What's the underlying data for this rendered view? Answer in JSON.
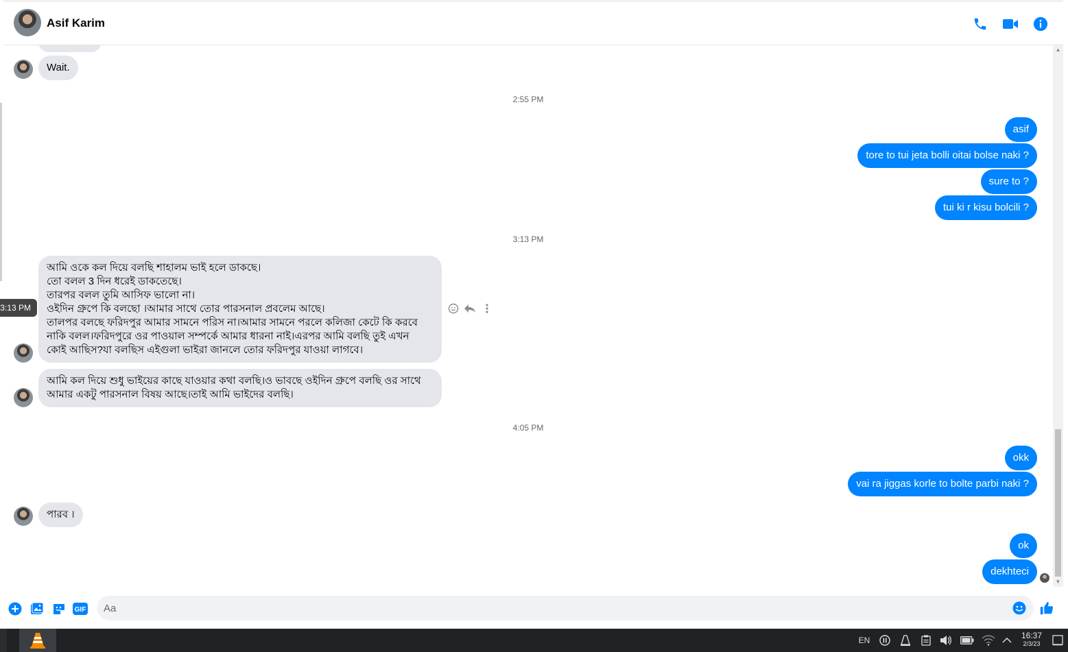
{
  "header": {
    "contact_name": "Asif Karim",
    "icons": [
      "phone-icon",
      "video-icon",
      "info-icon"
    ],
    "accent_color": "#0084ff"
  },
  "thread": {
    "messages": [
      {
        "direction": "in",
        "text": "Wait."
      },
      {
        "direction": "timestamp",
        "text": "2:55 PM"
      },
      {
        "direction": "out",
        "text": "asif"
      },
      {
        "direction": "out",
        "text": "tore to tui jeta bolli oitai bolse naki ?"
      },
      {
        "direction": "out",
        "text": "sure to ?"
      },
      {
        "direction": "out",
        "text": "tui ki r kisu bolcili ?"
      },
      {
        "direction": "timestamp",
        "text": "3:13 PM"
      },
      {
        "direction": "in",
        "text": "আমি ওকে কল দিয়ে বলছি শাহালম ভাই হলে ডাকছে।\nতো বলল 3 দিন ধরেই ডাকতেছে।\nতারপর বলল তুমি আসিফ ভালো না।\nওইদিন গ্রুপে কি বলছো ।আমার সাথে তোর পারসনাল প্রবলেম আছে।\nতালপর বলছে ফরিদপুর আমার সামনে পরিস না।আমার সামনে পরলে কলিজা কেটে কি করবে\nনাকি বলল।ফরিদপুরে ওর পাওয়াল সম্পর্কে আমার ধারনা নাই।এরপর আমি বলছি তুই এখন\nকোই আছিস?যা বলছিস এইগুলা ভাইরা জানলে তোর ফরিদপুর যাওয়া লাগবে।"
      },
      {
        "direction": "in",
        "text": "আমি কল দিয়ে শুধু ভাইয়ের কাছে যাওয়ার কথা বলছি।ও ভাবছে ওইদিন গ্রুপে বলছি ওর সাথে\nআমার একটু পারসনাল বিষয় আছে।তাই আমি ভাইদের বলছি।"
      },
      {
        "direction": "timestamp",
        "text": "4:05 PM"
      },
      {
        "direction": "out",
        "text": "okk"
      },
      {
        "direction": "out",
        "text": "vai ra jiggas korle to bolte parbi naki ?"
      },
      {
        "direction": "in",
        "text": "পারব ।"
      },
      {
        "direction": "out",
        "text": "ok"
      },
      {
        "direction": "out",
        "text": "dekhteci"
      }
    ],
    "hover_tooltip": "3:13 PM"
  },
  "composer": {
    "placeholder": "Aa",
    "value": "",
    "icons": [
      "add-icon",
      "photo-icon",
      "sticker-icon",
      "gif-icon",
      "emoji-icon",
      "like-icon"
    ],
    "gif_label": "GIF"
  },
  "taskbar": {
    "language": "EN",
    "time": "16:37",
    "date": "2/3/23"
  }
}
